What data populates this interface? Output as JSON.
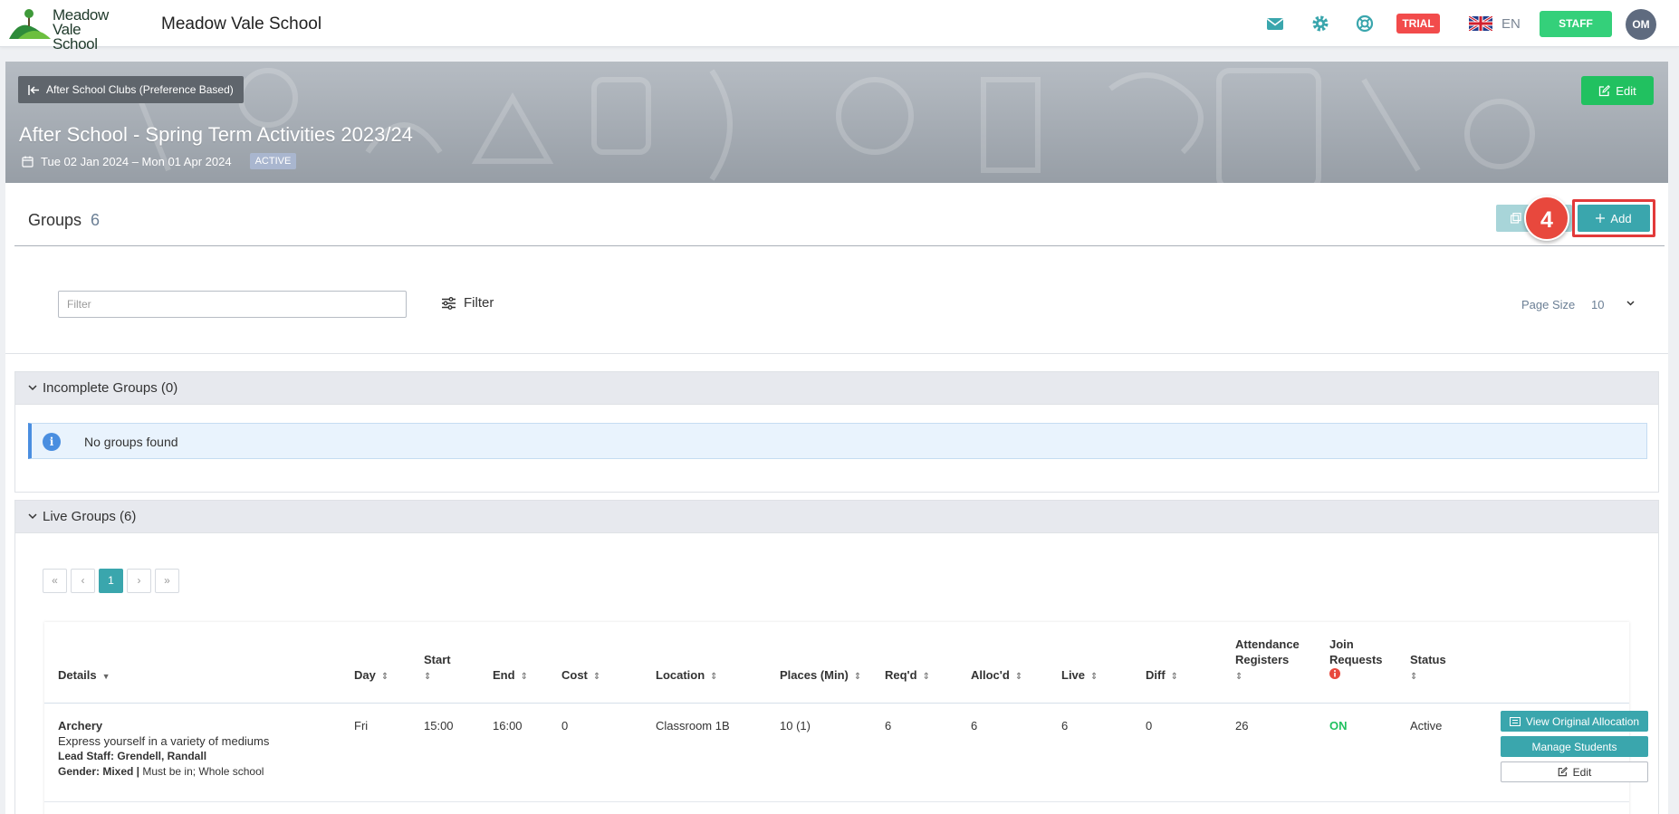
{
  "topbar": {
    "logo_line1": "Meadow",
    "logo_line2": "Vale School",
    "school_name": "Meadow Vale School",
    "trial_label": "TRIAL",
    "language": "EN",
    "staff_label": "STAFF",
    "avatar_initials": "OM"
  },
  "hero": {
    "back_label": "After School Clubs (Preference Based)",
    "title": "After School - Spring Term Activities 2023/24",
    "dates": "Tue 02 Jan 2024 – Mon 01 Apr 2024",
    "status": "ACTIVE",
    "edit_label": "Edit"
  },
  "groups": {
    "heading": "Groups",
    "count": "6",
    "step_number": "4",
    "add_label": "Add"
  },
  "filter": {
    "placeholder": "Filter",
    "button_label": "Filter",
    "page_size_label": "Page Size",
    "page_size_value": "10"
  },
  "incomplete": {
    "title": "Incomplete Groups (0)",
    "empty_message": "No groups found"
  },
  "live": {
    "title": "Live Groups (6)",
    "pager": [
      "«",
      "‹",
      "1",
      "›",
      "»"
    ],
    "columns": {
      "details": "Details",
      "day": "Day",
      "start": "Start",
      "end": "End",
      "cost": "Cost",
      "location": "Location",
      "places": "Places (Min)",
      "reqd": "Req'd",
      "allocd": "Alloc'd",
      "live": "Live",
      "diff": "Diff",
      "attendance_1": "Attendance",
      "attendance_2": "Registers",
      "join_1": "Join",
      "join_2": "Requests",
      "status": "Status"
    },
    "rows": [
      {
        "name": "Archery",
        "description": "Express yourself in a variety of mediums",
        "lead_staff": "Lead Staff: Grendell, Randall",
        "gender": "Gender: Mixed |",
        "restrictions": " Must be in; Whole school",
        "day": "Fri",
        "start": "15:00",
        "end": "16:00",
        "cost": "0",
        "location": "Classroom 1B",
        "places": "10 (1)",
        "reqd": "6",
        "allocd": "6",
        "live": "6",
        "diff": "0",
        "attendance": "26",
        "join_requests": "ON",
        "status": "Active",
        "btn_view": "View Original Allocation",
        "btn_manage": "Manage Students",
        "btn_edit": "Edit"
      }
    ]
  },
  "colors": {
    "teal": "#3aa6ad",
    "green": "#21c160",
    "trial_red": "#f24b4b",
    "highlight_red": "#e23a3a"
  }
}
